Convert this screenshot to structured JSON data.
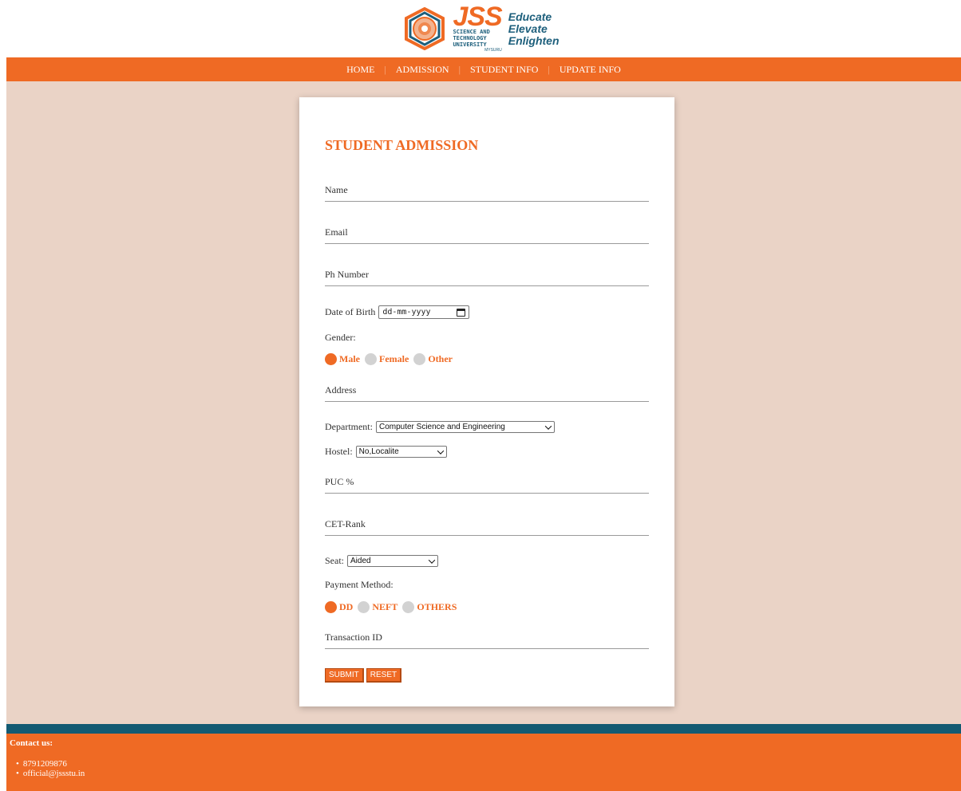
{
  "brand": {
    "logo_text": "JSS",
    "univ_line1": "SCIENCE AND",
    "univ_line2": "TECHNOLOGY",
    "univ_line3": "UNIVERSITY",
    "univ_city": "MYSURU",
    "tagline1": "Educate",
    "tagline2": "Elevate",
    "tagline3": "Enlighten"
  },
  "nav": {
    "items": [
      "HOME",
      "ADMISSION",
      "STUDENT INFO",
      "UPDATE INFO"
    ],
    "separator": "|"
  },
  "form": {
    "title": "STUDENT ADMISSION",
    "name_label": "Name",
    "email_label": "Email",
    "phone_label": "Ph Number",
    "dob_label": "Date of Birth",
    "dob_placeholder": "dd-mm-yyyy",
    "gender_label": "Gender:",
    "gender_options": [
      "Male",
      "Female",
      "Other"
    ],
    "gender_selected": "Male",
    "address_label": "Address",
    "department_label": "Department:",
    "department_value": "Computer Science and Engineering",
    "hostel_label": "Hostel:",
    "hostel_value": "No,Localite",
    "puc_label": "PUC %",
    "cet_label": "CET-Rank",
    "seat_label": "Seat:",
    "seat_value": "Aided",
    "payment_label": "Payment Method:",
    "payment_options": [
      "DD",
      "NEFT",
      "OTHERS"
    ],
    "payment_selected": "DD",
    "transaction_label": "Transaction ID",
    "submit_label": "SUBMIT",
    "reset_label": "RESET"
  },
  "footer": {
    "title": "Contact us:",
    "phone": "8791209876",
    "email": "official@jssstu.in"
  },
  "colors": {
    "accent": "#ef6a24",
    "page_bg": "#ead3c6",
    "footer_strip": "#135a72"
  }
}
